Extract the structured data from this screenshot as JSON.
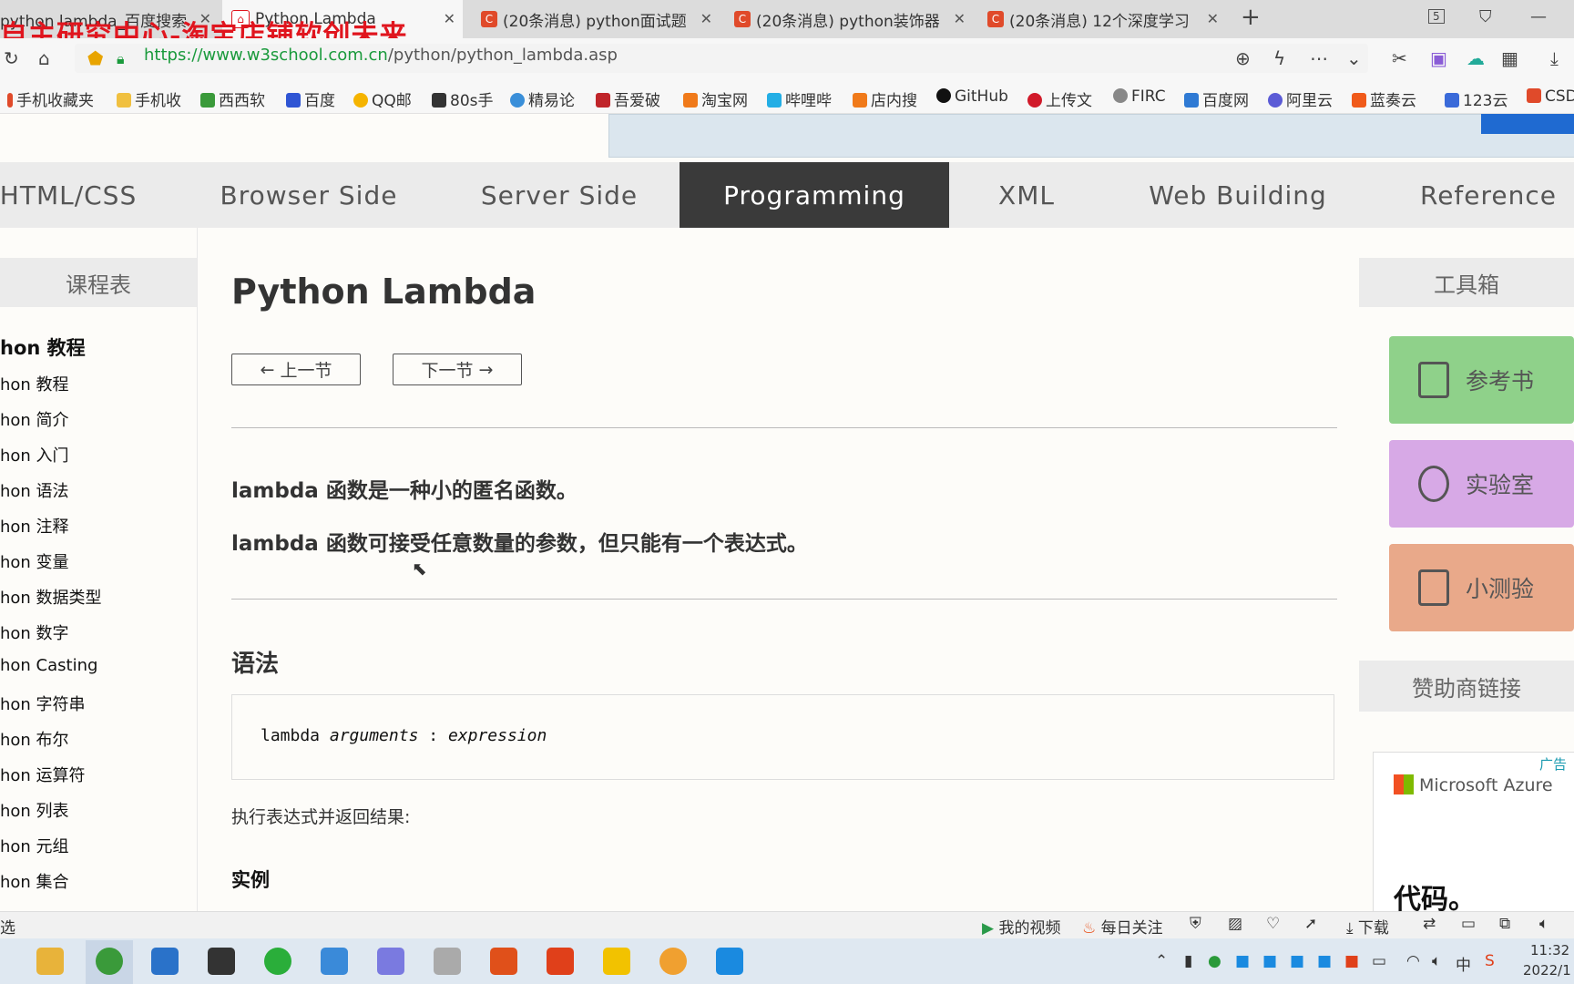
{
  "browser": {
    "tabs": [
      {
        "label": "python lambda_百度搜索"
      },
      {
        "label": "Python Lambda"
      },
      {
        "label": "(20条消息) python面试题"
      },
      {
        "label": "(20条消息) python装饰器"
      },
      {
        "label": "(20条消息) 12个深度学习"
      }
    ],
    "tab_count": "5",
    "watermark": "自主研究中心-淘宝店铺软创未来",
    "url_host": "https://www.w3school.com.cn",
    "url_path": "/python/python_lambda.asp",
    "bookmarks": [
      "手机收藏夹",
      "手机收",
      "西西软",
      "百度",
      "QQ邮",
      "80s手",
      "精易论",
      "吾爱破",
      "淘宝网",
      "哔哩哔",
      "店内搜",
      "GitHub",
      "上传文",
      "FIRC",
      "百度网",
      "阿里云",
      "蓝奏云",
      "123云",
      "CSD"
    ]
  },
  "nav": {
    "items": [
      "HTML/CSS",
      "Browser Side",
      "Server Side",
      "Programming",
      "XML",
      "Web Building",
      "Reference"
    ],
    "active": "Programming"
  },
  "left_sidebar": {
    "heading": "课程表",
    "items": [
      "hon 教程",
      "hon 教程",
      "hon 简介",
      "hon 入门",
      "hon 语法",
      "hon 注释",
      "hon 变量",
      "hon 数据类型",
      "hon 数字",
      "hon Casting",
      "hon 字符串",
      "hon 布尔",
      "hon 运算符",
      "hon 列表",
      "hon 元组",
      "hon 集合"
    ]
  },
  "main": {
    "title": "Python Lambda",
    "prev_label": "上一节",
    "next_label": "下一节",
    "p1": "lambda 函数是一种小的匿名函数。",
    "p2": "lambda 函数可接受任意数量的参数，但只能有一个表达式。",
    "syntax_heading": "语法",
    "code_keyword": "lambda",
    "code_args": "arguments",
    "code_sep": ":",
    "code_expr": "expression",
    "exec_text": "执行表达式并返回结果:",
    "example_heading": "实例"
  },
  "right_sidebar": {
    "heading": "工具箱",
    "tools": [
      {
        "label": "参考书",
        "color": "#8fd18a",
        "icon": "book-icon"
      },
      {
        "label": "实验室",
        "color": "#d7a9e6",
        "icon": "atom-icon"
      },
      {
        "label": "小测验",
        "color": "#e9a98a",
        "icon": "clipboard-icon"
      }
    ],
    "sponsor_heading": "赞助商链接",
    "ad_tag": "广告",
    "ad_brand": "Microsoft Azure",
    "ad_text": "代码。"
  },
  "statusbar": {
    "left": "选",
    "my_videos": "我的视频",
    "daily": "每日关注",
    "download": "下载"
  },
  "taskbar": {
    "time": "11:32",
    "date": "2022/1",
    "ime": "中"
  }
}
